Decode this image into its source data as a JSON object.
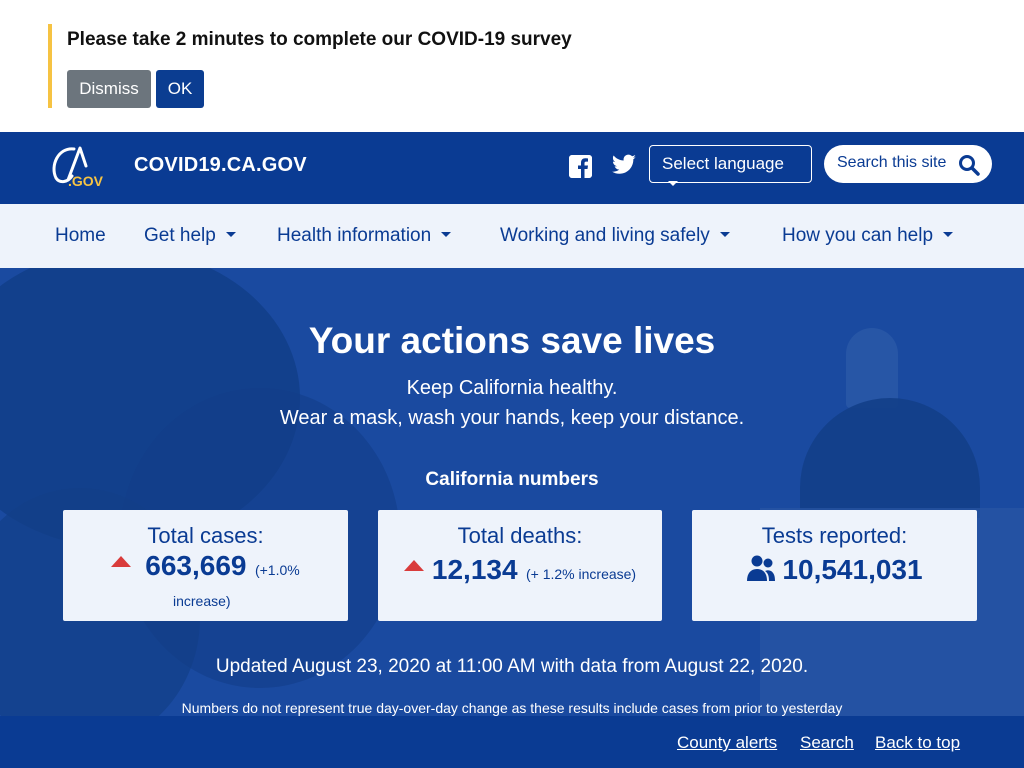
{
  "survey": {
    "text": "Please take 2 minutes to complete our COVID-19 survey",
    "dismiss_label": "Dismiss",
    "ok_label": "OK"
  },
  "header": {
    "logo_text": "CA.GOV",
    "site_title": "COVID19.CA.GOV",
    "language_label": "Select language",
    "search_label": "Search this site"
  },
  "nav": {
    "items": [
      {
        "label": "Home"
      },
      {
        "label": "Get help"
      },
      {
        "label": "Health information"
      },
      {
        "label": "Working and living safely"
      },
      {
        "label": "How you can help"
      }
    ]
  },
  "hero": {
    "title": "Your actions save lives",
    "subtitle_line1": "Keep California healthy.",
    "subtitle_line2": "Wear a mask, wash your hands, keep your distance.",
    "numbers_heading": "California numbers",
    "cards": [
      {
        "label": "Total cases:",
        "value": "663,669",
        "note_a": "(+1.0%",
        "note_b": "increase)"
      },
      {
        "label": "Total deaths:",
        "value": "12,134",
        "note": "(+ 1.2% increase)"
      },
      {
        "label": "Tests reported:",
        "value": "10,541,031"
      }
    ],
    "updated": "Updated August 23, 2020 at 11:00 AM with data from August 22, 2020.",
    "disclaimer": "Numbers do not represent true day-over-day change as these results include cases from prior to yesterday"
  },
  "footer": {
    "links": [
      {
        "label": "County alerts"
      },
      {
        "label": "Search"
      },
      {
        "label": "Back to top"
      }
    ]
  },
  "colors": {
    "brand_blue": "#0a3b93",
    "hero_blue": "#1a4aa0",
    "survey_accent": "#f6c343",
    "increase_red": "#d93b3b",
    "dismiss_gray": "#6c757d"
  }
}
